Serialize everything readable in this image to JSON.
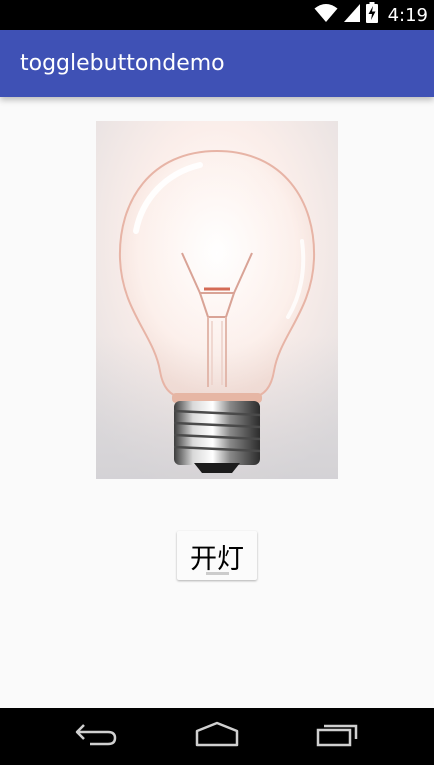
{
  "status_bar": {
    "time": "4:19",
    "icons": [
      "wifi-icon",
      "cell-signal-icon",
      "battery-charging-icon"
    ]
  },
  "app_bar": {
    "title": "togglebuttondemo",
    "color": "#3f51b5"
  },
  "main": {
    "image": {
      "icon": "light-bulb-image"
    },
    "toggle": {
      "label": "开灯",
      "checked": false,
      "indicator_color": "#cccccc"
    }
  },
  "nav_bar": {
    "buttons": [
      "back-icon",
      "home-icon",
      "recent-apps-icon"
    ]
  }
}
